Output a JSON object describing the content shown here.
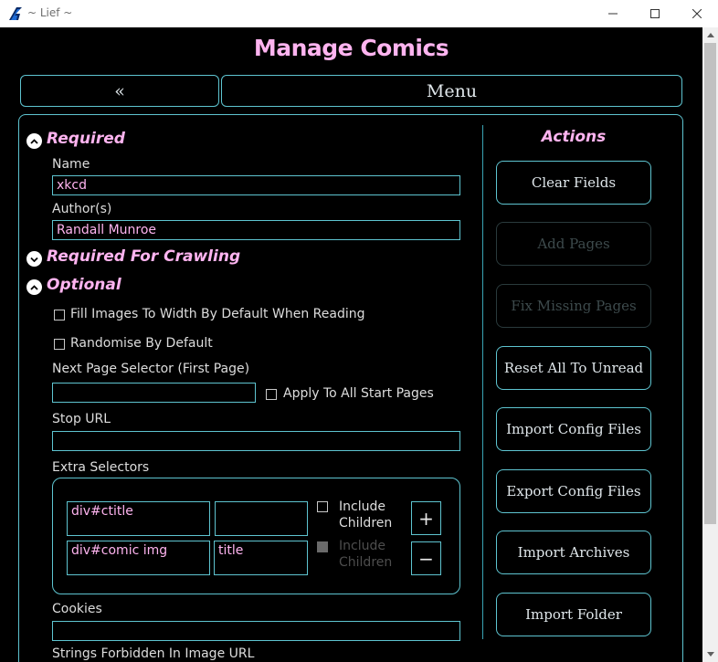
{
  "window": {
    "title": "~ Lief ~",
    "logo": "lief-logo-icon"
  },
  "header": {
    "title": "Manage Comics",
    "back_label": "«",
    "menu_label": "Menu"
  },
  "sections": {
    "required": {
      "title": "Required",
      "expanded": true
    },
    "crawling": {
      "title": "Required For Crawling",
      "expanded": false
    },
    "optional": {
      "title": "Optional",
      "expanded": true
    }
  },
  "fields": {
    "name": {
      "label": "Name",
      "value": "xkcd"
    },
    "authors": {
      "label": "Author(s)",
      "value": "Randall Munroe"
    },
    "fill_width": {
      "label": "Fill Images To Width By Default When Reading",
      "checked": false
    },
    "randomise": {
      "label": "Randomise By Default",
      "checked": false
    },
    "next_page": {
      "label": "Next Page Selector (First Page)",
      "value": ""
    },
    "apply_all": {
      "label": "Apply To All Start Pages",
      "checked": false
    },
    "stop_url": {
      "label": "Stop URL",
      "value": ""
    },
    "extra_selectors": {
      "label": "Extra Selectors",
      "rows": [
        {
          "selector": "div#ctitle",
          "attribute": "",
          "include_label": "Include Children",
          "include_checked": false,
          "include_enabled": true,
          "button": "+"
        },
        {
          "selector": "div#comic img",
          "attribute": "title",
          "include_label": "Include Children",
          "include_checked": false,
          "include_enabled": false,
          "button": "−"
        }
      ]
    },
    "cookies": {
      "label": "Cookies",
      "value": ""
    },
    "forbidden": {
      "label": "Strings Forbidden In Image URL"
    }
  },
  "actions": {
    "title": "Actions",
    "buttons": [
      {
        "label": "Clear Fields",
        "enabled": true
      },
      {
        "label": "Add Pages",
        "enabled": false
      },
      {
        "label": "Fix Missing Pages",
        "enabled": false
      },
      {
        "label": "Reset All To Unread",
        "enabled": true
      },
      {
        "label": "Import Config Files",
        "enabled": true
      },
      {
        "label": "Export Config Files",
        "enabled": true
      },
      {
        "label": "Import Archives",
        "enabled": true
      },
      {
        "label": "Import Folder",
        "enabled": true
      }
    ]
  },
  "colors": {
    "accent": "#5ec4d0",
    "heading": "#ffb4f0",
    "background": "#000000",
    "text": "#dddddd"
  }
}
